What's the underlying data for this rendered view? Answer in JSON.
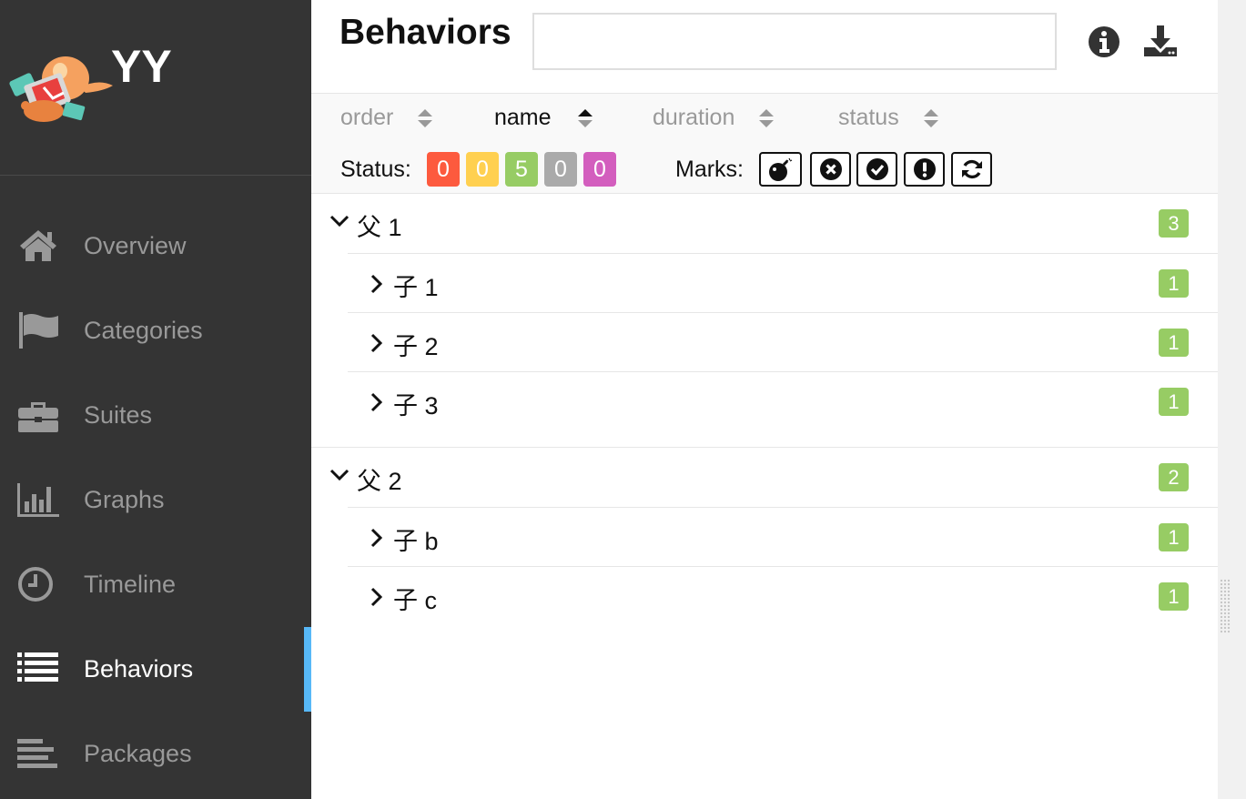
{
  "brand": {
    "title": "YY"
  },
  "nav": [
    {
      "label": "Overview",
      "icon": "home-icon"
    },
    {
      "label": "Categories",
      "icon": "flag-icon"
    },
    {
      "label": "Suites",
      "icon": "briefcase-icon"
    },
    {
      "label": "Graphs",
      "icon": "bar-chart-icon"
    },
    {
      "label": "Timeline",
      "icon": "clock-icon"
    },
    {
      "label": "Behaviors",
      "icon": "list-icon",
      "active": true
    },
    {
      "label": "Packages",
      "icon": "align-left-icon"
    }
  ],
  "header": {
    "title": "Behaviors",
    "search_value": "",
    "search_placeholder": ""
  },
  "sorters": [
    {
      "label": "order",
      "active": false
    },
    {
      "label": "name",
      "active": true
    },
    {
      "label": "duration",
      "active": false
    },
    {
      "label": "status",
      "active": false
    }
  ],
  "status": {
    "label": "Status:",
    "counts": [
      {
        "name": "failed",
        "value": "0",
        "color": "#fd5a3e"
      },
      {
        "name": "broken",
        "value": "0",
        "color": "#ffd050"
      },
      {
        "name": "passed",
        "value": "5",
        "color": "#97cc64"
      },
      {
        "name": "skipped",
        "value": "0",
        "color": "#aaaaaa"
      },
      {
        "name": "unknown",
        "value": "0",
        "color": "#d35ebe"
      }
    ]
  },
  "marks": {
    "label": "Marks:",
    "items": [
      "bomb-icon",
      "times-circle-icon",
      "check-circle-icon",
      "exclamation-circle-icon",
      "refresh-icon"
    ]
  },
  "tree": [
    {
      "name": "父 1",
      "count": "3",
      "children": [
        {
          "name": "子 1",
          "count": "1"
        },
        {
          "name": "子 2",
          "count": "1"
        },
        {
          "name": "子 3",
          "count": "1"
        }
      ]
    },
    {
      "name": "父 2",
      "count": "2",
      "children": [
        {
          "name": "子 b",
          "count": "1"
        },
        {
          "name": "子 c",
          "count": "1"
        }
      ]
    }
  ]
}
